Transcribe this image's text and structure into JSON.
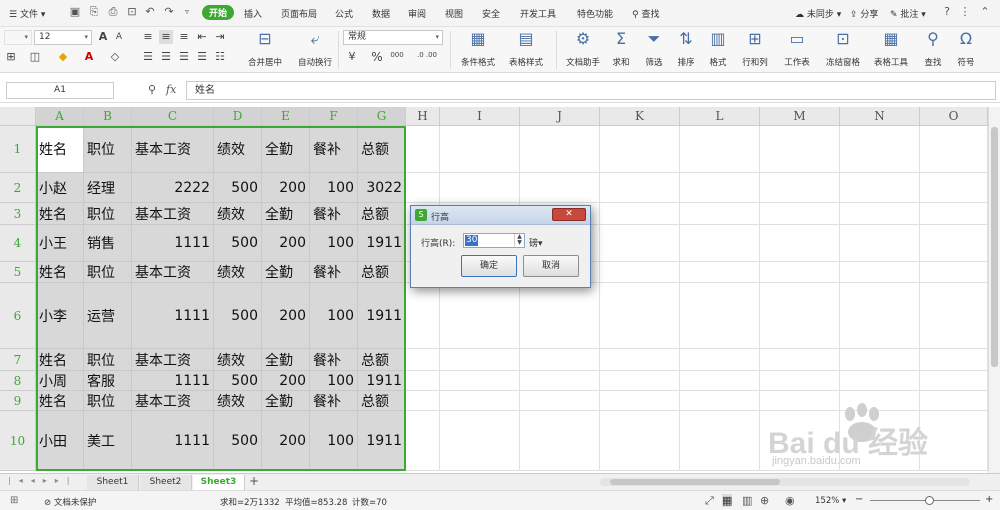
{
  "menu": {
    "file": "文件",
    "tabs": [
      "开始",
      "插入",
      "页面布局",
      "公式",
      "数据",
      "审阅",
      "视图",
      "安全",
      "开发工具",
      "特色功能"
    ],
    "search": "查找",
    "right": [
      "未同步",
      "分享",
      "批注"
    ]
  },
  "ribbon": {
    "font_size": "12",
    "number_format": "常规",
    "merge": "合并居中",
    "wrap": "自动换行",
    "percent": "%",
    "thousands": "000",
    "decimals": ".0 .00",
    "big_buttons": [
      "条件格式",
      "表格样式",
      "文档助手",
      "求和",
      "筛选",
      "排序",
      "格式",
      "行和列",
      "工作表",
      "冻结窗格",
      "表格工具",
      "查找",
      "符号"
    ]
  },
  "formula_bar": {
    "cell_ref": "A1",
    "fx": "fx",
    "content": "姓名"
  },
  "columns": [
    "A",
    "B",
    "C",
    "D",
    "E",
    "F",
    "G",
    "H",
    "I",
    "J",
    "K",
    "L",
    "M",
    "N",
    "O"
  ],
  "rows": [
    "1",
    "2",
    "3",
    "4",
    "5",
    "6",
    "7",
    "8",
    "9",
    "10"
  ],
  "cells": [
    [
      "姓名",
      "职位",
      "基本工资",
      "绩效",
      "全勤",
      "餐补",
      "总额"
    ],
    [
      "小赵",
      "经理",
      "2222",
      "500",
      "200",
      "100",
      "3022"
    ],
    [
      "姓名",
      "职位",
      "基本工资",
      "绩效",
      "全勤",
      "餐补",
      "总额"
    ],
    [
      "小王",
      "销售",
      "1111",
      "500",
      "200",
      "100",
      "1911"
    ],
    [
      "姓名",
      "职位",
      "基本工资",
      "绩效",
      "全勤",
      "餐补",
      "总额"
    ],
    [
      "小李",
      "运营",
      "1111",
      "500",
      "200",
      "100",
      "1911"
    ],
    [
      "姓名",
      "职位",
      "基本工资",
      "绩效",
      "全勤",
      "餐补",
      "总额"
    ],
    [
      "小周",
      "客服",
      "1111",
      "500",
      "200",
      "100",
      "1911"
    ],
    [
      "姓名",
      "职位",
      "基本工资",
      "绩效",
      "全勤",
      "餐补",
      "总额"
    ],
    [
      "小田",
      "美工",
      "1111",
      "500",
      "200",
      "100",
      "1911"
    ]
  ],
  "sheets": [
    "Sheet1",
    "Sheet2",
    "Sheet3"
  ],
  "active_sheet": "Sheet3",
  "dialog": {
    "title": "行高",
    "label": "行高(R):",
    "value": "30",
    "unit": "磅",
    "ok": "确定",
    "cancel": "取消"
  },
  "status": {
    "protect": "文档未保护",
    "sum": "求和=2万1332",
    "avg": "平均值=853.28",
    "count": "计数=70",
    "zoom": "152%"
  },
  "watermark": {
    "brand": "Bai du 经验",
    "url": "jingyan.baidu.com"
  },
  "colors": {
    "accent": "#3ea834",
    "selection": "#d8d8d8",
    "dialog_border": "#5b7fb3"
  }
}
